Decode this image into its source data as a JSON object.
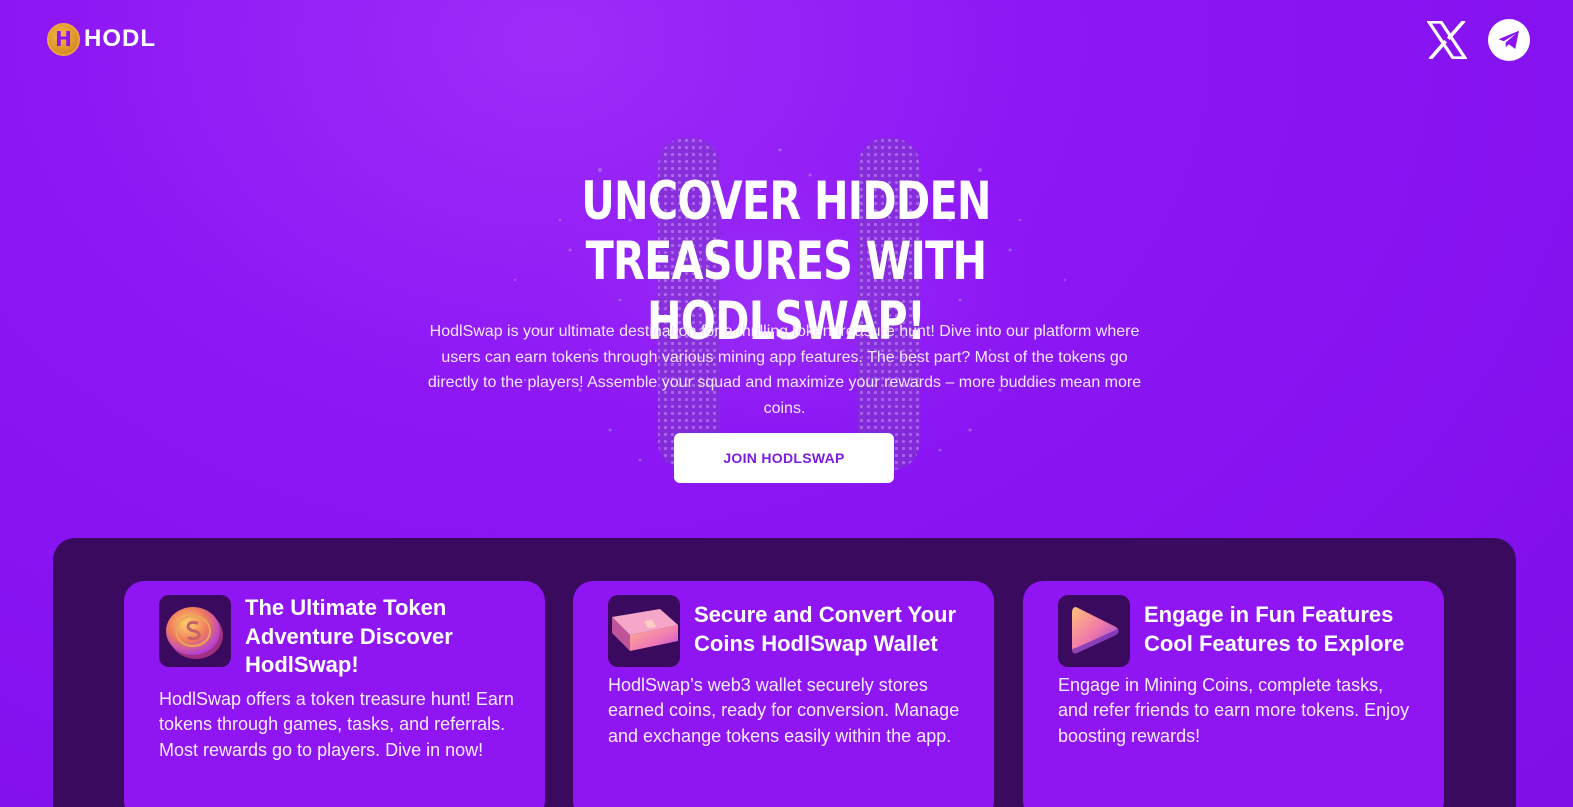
{
  "header": {
    "logo_mark": "H",
    "logo_text": "HODL",
    "social": [
      {
        "name": "x-icon"
      },
      {
        "name": "telegram-icon"
      }
    ]
  },
  "hero": {
    "title": "UNCOVER HIDDEN TREASURES WITH HODLSWAP!",
    "description": "HodlSwap is your ultimate destination for a thrilling token treasure hunt! Dive into our platform where users can earn tokens through various mining app features. The best part? Most of the tokens go directly to the players! Assemble your squad and maximize your rewards – more buddies mean more coins.",
    "cta_label": "JOIN HODLSWAP"
  },
  "features": [
    {
      "icon": "coin-icon",
      "title": "The Ultimate Token Adventure Discover HodlSwap!",
      "text": "HodlSwap offers a token treasure hunt! Earn tokens through games, tasks, and referrals. Most rewards go to players. Dive in now!"
    },
    {
      "icon": "wallet-icon",
      "title": "Secure and Convert Your Coins HodlSwap Wallet",
      "text": "HodlSwap’s web3 wallet securely stores earned coins, ready for conversion. Manage and exchange tokens easily within the app."
    },
    {
      "icon": "play-icon",
      "title": "Engage in Fun Features Cool Features to Explore",
      "text": "Engage in Mining Coins, complete tasks, and refer friends to earn more tokens. Enjoy boosting rewards!"
    }
  ],
  "colors": {
    "background": "#8d17f5",
    "panel": "#3a0a5e",
    "card": "#8f15f2",
    "cta_text": "#7d1ce0"
  }
}
